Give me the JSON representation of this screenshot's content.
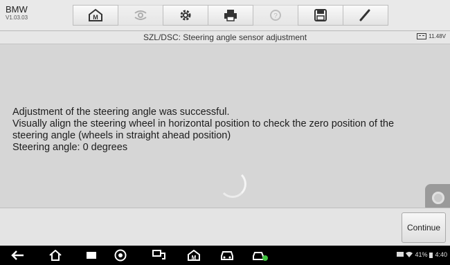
{
  "app": {
    "name": "BMW",
    "version": "V1.03.03"
  },
  "toolbar": {
    "items": [
      {
        "icon": "home-icon",
        "enabled": true
      },
      {
        "icon": "vehicle-swap-icon",
        "enabled": false
      },
      {
        "icon": "gear-icon",
        "enabled": true
      },
      {
        "icon": "printer-icon",
        "enabled": true
      },
      {
        "icon": "help-icon",
        "enabled": false
      },
      {
        "icon": "save-icon",
        "enabled": true
      },
      {
        "icon": "pen-icon",
        "enabled": true
      }
    ]
  },
  "header": {
    "title": "SZL/DSC: Steering angle sensor adjustment",
    "voltage": "11.48V"
  },
  "message": {
    "line1": "Adjustment of the steering angle was successful.",
    "line2": "Visually align the steering wheel in horizontal position to check the zero position of the",
    "line3": "steering angle (wheels in straight ahead position)",
    "line4": "Steering angle: 0 degrees"
  },
  "actions": {
    "continue_label": "Continue"
  },
  "system": {
    "battery": "41%",
    "time": "4:40"
  }
}
